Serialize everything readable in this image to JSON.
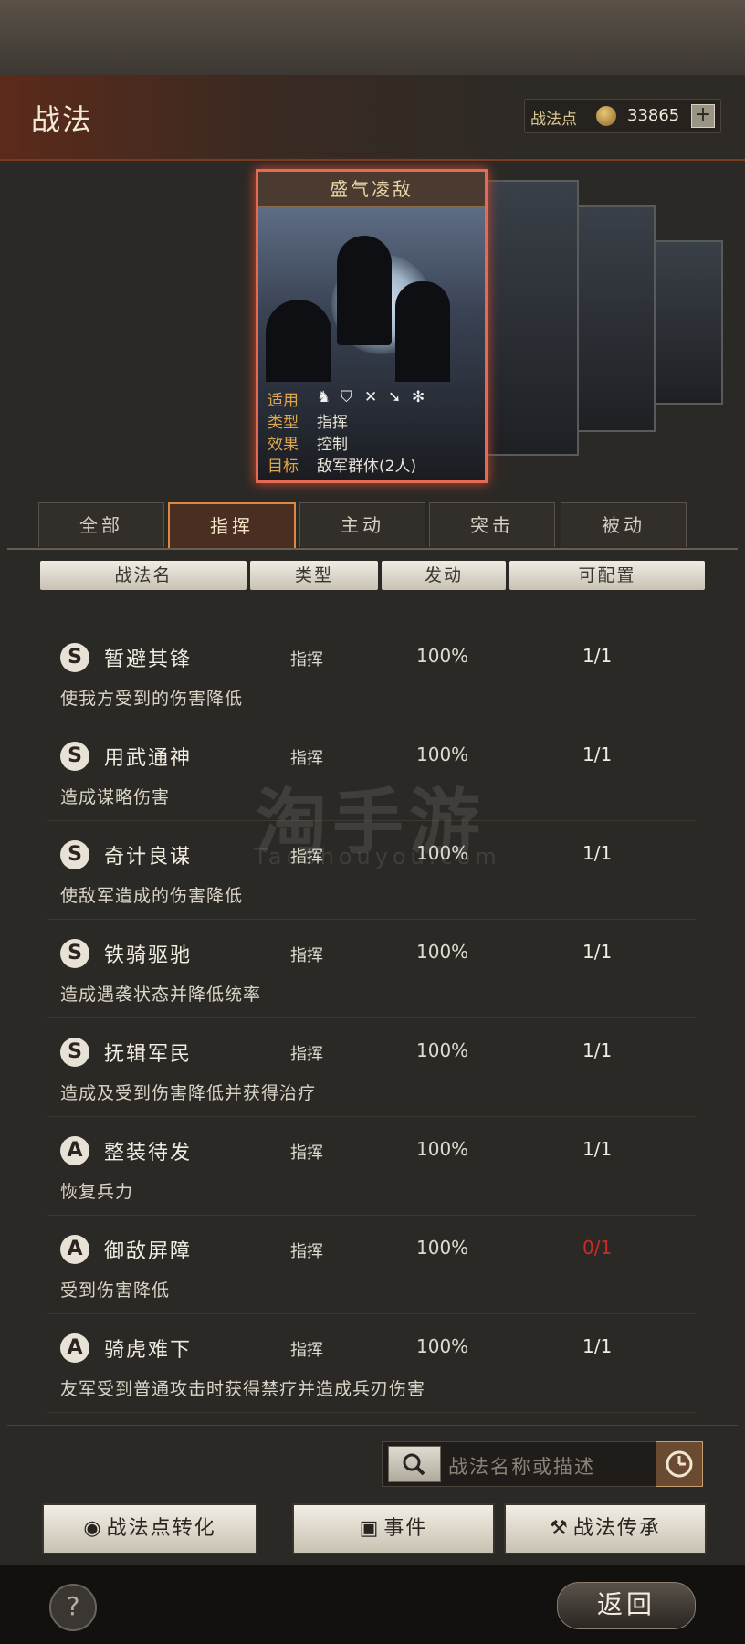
{
  "header": {
    "title": "战法",
    "points_label": "战法点",
    "points_value": "33865",
    "plus_label": "+"
  },
  "card": {
    "title": "盛气凌敌",
    "apply_key": "适用",
    "apply_icons": [
      "cavalry-icon",
      "shield-icon",
      "bow-icon",
      "spear-icon",
      "wheel-icon"
    ],
    "type_key": "类型",
    "type_value": "指挥",
    "effect_key": "效果",
    "effect_value": "控制",
    "target_key": "目标",
    "target_value": "敌军群体(2人)"
  },
  "tabs": [
    "全部",
    "指挥",
    "主动",
    "突击",
    "被动"
  ],
  "active_tab": "指挥",
  "columns": [
    "战法名",
    "类型",
    "发动",
    "可配置"
  ],
  "rows": [
    {
      "rank": "S",
      "name": "暂避其锋",
      "type": "指挥",
      "trigger": "100%",
      "slots": "1/1",
      "desc": "使我方受到的伤害降低"
    },
    {
      "rank": "S",
      "name": "用武通神",
      "type": "指挥",
      "trigger": "100%",
      "slots": "1/1",
      "desc": "造成谋略伤害"
    },
    {
      "rank": "S",
      "name": "奇计良谋",
      "type": "指挥",
      "trigger": "100%",
      "slots": "1/1",
      "desc": "使敌军造成的伤害降低"
    },
    {
      "rank": "S",
      "name": "铁骑驱驰",
      "type": "指挥",
      "trigger": "100%",
      "slots": "1/1",
      "desc": "造成遇袭状态并降低统率"
    },
    {
      "rank": "S",
      "name": "抚辑军民",
      "type": "指挥",
      "trigger": "100%",
      "slots": "1/1",
      "desc": "造成及受到伤害降低并获得治疗"
    },
    {
      "rank": "A",
      "name": "整装待发",
      "type": "指挥",
      "trigger": "100%",
      "slots": "1/1",
      "desc": "恢复兵力"
    },
    {
      "rank": "A",
      "name": "御敌屏障",
      "type": "指挥",
      "trigger": "100%",
      "slots": "0/1",
      "desc": "受到伤害降低"
    },
    {
      "rank": "A",
      "name": "骑虎难下",
      "type": "指挥",
      "trigger": "100%",
      "slots": "1/1",
      "desc": "友军受到普通攻击时获得禁疗并造成兵刃伤害"
    }
  ],
  "search": {
    "placeholder": "战法名称或描述"
  },
  "actions": {
    "convert": "战法点转化",
    "events": "事件",
    "inherit": "战法传承"
  },
  "footer": {
    "help": "?",
    "back": "返回"
  },
  "watermark": {
    "main": "淘手游",
    "sub": "Taoshouyou.com"
  },
  "colors": {
    "accent": "#e0883e",
    "card_border": "#e36a55",
    "warning": "#d02a24"
  }
}
